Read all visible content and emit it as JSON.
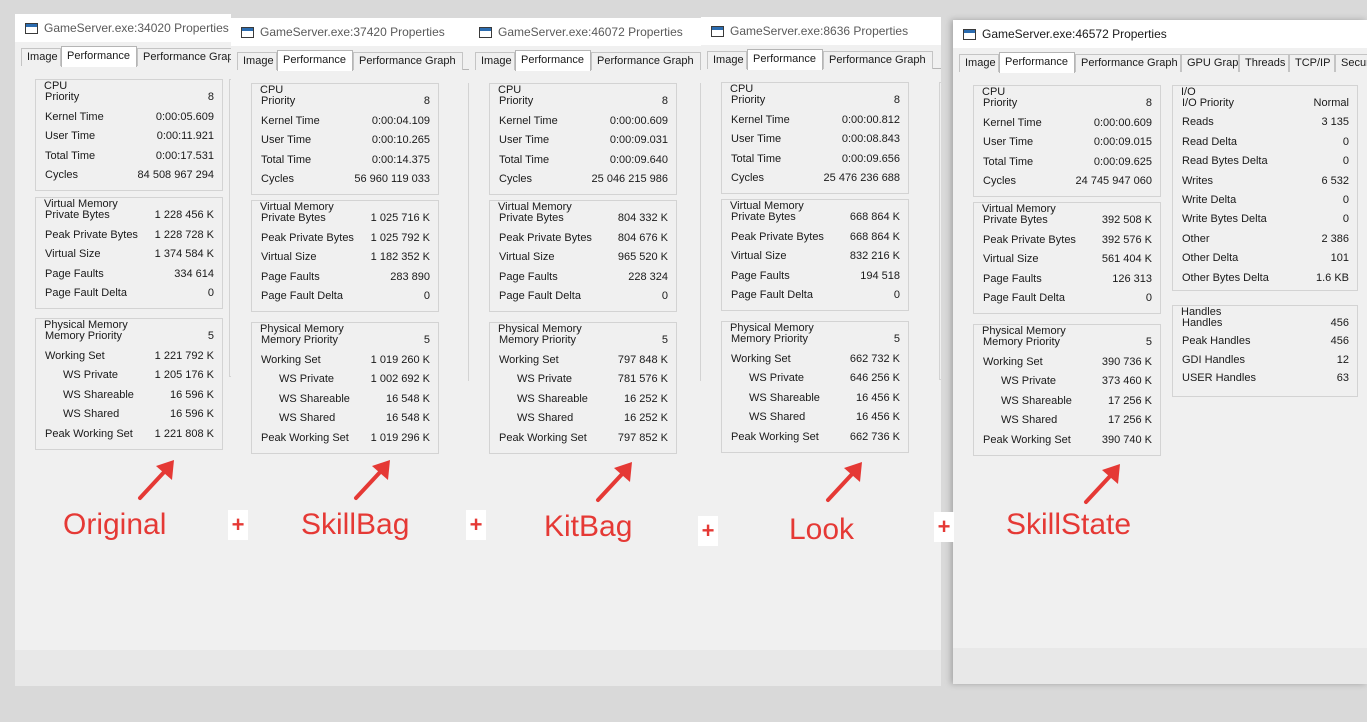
{
  "tab_labels": {
    "image": "Image",
    "performance": "Performance",
    "performance_graph": "Performance Graph",
    "gpu_graph": "GPU Graph",
    "threads": "Threads",
    "tcpip": "TCP/IP",
    "security": "Security"
  },
  "group_titles": {
    "cpu": "CPU",
    "virtual_memory": "Virtual Memory",
    "physical_memory": "Physical Memory",
    "io": "I/O",
    "handles": "Handles"
  },
  "row_labels": {
    "priority": "Priority",
    "kernel_time": "Kernel Time",
    "user_time": "User Time",
    "total_time": "Total Time",
    "cycles": "Cycles",
    "private_bytes": "Private Bytes",
    "peak_private_bytes": "Peak Private Bytes",
    "virtual_size": "Virtual Size",
    "page_faults": "Page Faults",
    "page_fault_delta": "Page Fault Delta",
    "memory_priority": "Memory Priority",
    "working_set": "Working Set",
    "ws_private": "WS Private",
    "ws_shareable": "WS Shareable",
    "ws_shared": "WS Shared",
    "peak_working_set": "Peak Working Set"
  },
  "windows": [
    {
      "title": "GameServer.exe:34020 Properties",
      "label": "Original",
      "cpu": [
        "8",
        "0:00:05.609",
        "0:00:11.921",
        "0:00:17.531",
        "84 508 967 294"
      ],
      "vm": [
        "1 228 456 K",
        "1 228 728 K",
        "1 374 584 K",
        "334 614",
        "0"
      ],
      "pm": [
        "5",
        "1 221 792 K",
        "1 205 176 K",
        "16 596 K",
        "16 596 K",
        "1 221 808 K"
      ]
    },
    {
      "title": "GameServer.exe:37420 Properties",
      "label": "SkillBag",
      "cpu": [
        "8",
        "0:00:04.109",
        "0:00:10.265",
        "0:00:14.375",
        "56 960 119 033"
      ],
      "vm": [
        "1 025 716 K",
        "1 025 792 K",
        "1 182 352 K",
        "283 890",
        "0"
      ],
      "pm": [
        "5",
        "1 019 260 K",
        "1 002 692 K",
        "16 548 K",
        "16 548 K",
        "1 019 296 K"
      ]
    },
    {
      "title": "GameServer.exe:46072 Properties",
      "label": "KitBag",
      "cpu": [
        "8",
        "0:00:00.609",
        "0:00:09.031",
        "0:00:09.640",
        "25 046 215 986"
      ],
      "vm": [
        "804 332 K",
        "804 676 K",
        "965 520 K",
        "228 324",
        "0"
      ],
      "pm": [
        "5",
        "797 848 K",
        "781 576 K",
        "16 252 K",
        "16 252 K",
        "797 852 K"
      ]
    },
    {
      "title": "GameServer.exe:8636 Properties",
      "label": "Look",
      "cpu": [
        "8",
        "0:00:00.812",
        "0:00:08.843",
        "0:00:09.656",
        "25 476 236 688"
      ],
      "vm": [
        "668 864 K",
        "668 864 K",
        "832 216 K",
        "194 518",
        "0"
      ],
      "pm": [
        "5",
        "662 732 K",
        "646 256 K",
        "16 456 K",
        "16 456 K",
        "662 736 K"
      ]
    },
    {
      "title": "GameServer.exe:46572 Properties",
      "label": "SkillState",
      "cpu": [
        "8",
        "0:00:00.609",
        "0:00:09.015",
        "0:00:09.625",
        "24 745 947 060"
      ],
      "vm": [
        "392 508 K",
        "392 576 K",
        "561 404 K",
        "126 313",
        "0"
      ],
      "pm": [
        "5",
        "390 736 K",
        "373 460 K",
        "17 256 K",
        "17 256 K",
        "390 740 K"
      ]
    }
  ],
  "io": [
    {
      "label": "I/O Priority",
      "value": "Normal"
    },
    {
      "label": "Reads",
      "value": "3 135"
    },
    {
      "label": "Read Delta",
      "value": "0"
    },
    {
      "label": "Read Bytes Delta",
      "value": "0"
    },
    {
      "label": "Writes",
      "value": "6 532"
    },
    {
      "label": "Write Delta",
      "value": "0"
    },
    {
      "label": "Write Bytes Delta",
      "value": "0"
    },
    {
      "label": "Other",
      "value": "2 386"
    },
    {
      "label": "Other Delta",
      "value": "101"
    },
    {
      "label": "Other Bytes Delta",
      "value": "1.6  KB"
    }
  ],
  "handles": [
    {
      "label": "Handles",
      "value": "456"
    },
    {
      "label": "Peak Handles",
      "value": "456"
    },
    {
      "label": "GDI Handles",
      "value": "12"
    },
    {
      "label": "USER Handles",
      "value": "63"
    }
  ],
  "plus_sign": "+",
  "colors": {
    "annotation": "#e53935",
    "title_icon": "#2b6cb0"
  }
}
